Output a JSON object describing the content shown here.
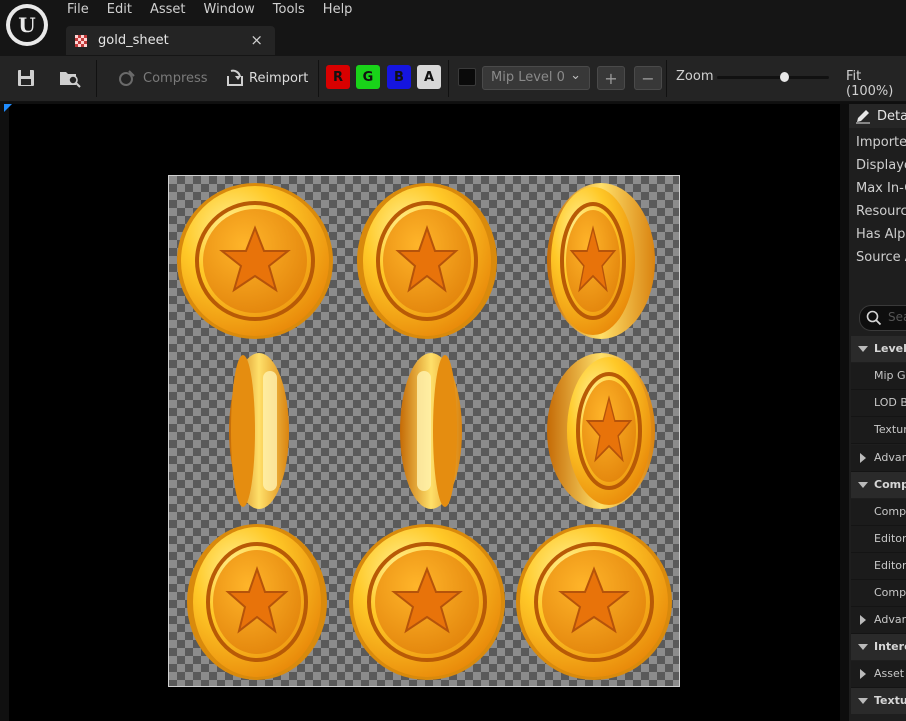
{
  "menu": [
    "File",
    "Edit",
    "Asset",
    "Window",
    "Tools",
    "Help"
  ],
  "tab": {
    "label": "gold_sheet",
    "close": "×"
  },
  "toolbar": {
    "compress": "Compress",
    "reimport": "Reimport",
    "channels": [
      {
        "label": "R",
        "bg": "#d80000",
        "fg": "#111111"
      },
      {
        "label": "G",
        "bg": "#19d319",
        "fg": "#111111"
      },
      {
        "label": "B",
        "bg": "#1515e0",
        "fg": "#111111"
      },
      {
        "label": "A",
        "bg": "#d8d8d8",
        "fg": "#111111"
      }
    ],
    "mip_level": "Mip Level 0",
    "plus": "+",
    "minus": "−",
    "zoom_label": "Zoom",
    "zoom_value": 0.6,
    "fit": "Fit (100%)"
  },
  "details": {
    "title": "Details",
    "properties": [
      "Imported",
      "Displayed",
      "Max In-Game",
      "Resource",
      "Has Alpha",
      "Source A"
    ],
    "search_placeholder": "Search",
    "sections": [
      {
        "kind": "section",
        "label": "Level Of Detail",
        "expanded": true
      },
      {
        "kind": "row",
        "label": "Mip Gen Settings"
      },
      {
        "kind": "row",
        "label": "LOD Bias"
      },
      {
        "kind": "row",
        "label": "Texture Group"
      },
      {
        "kind": "collapsed",
        "label": "Advanced"
      },
      {
        "kind": "section",
        "label": "Compression",
        "expanded": true
      },
      {
        "kind": "row",
        "label": "Compression Settings"
      },
      {
        "kind": "row",
        "label": "Editor Default"
      },
      {
        "kind": "row",
        "label": "Editor Override"
      },
      {
        "kind": "row",
        "label": "Compression Quality"
      },
      {
        "kind": "collapsed",
        "label": "Advanced"
      },
      {
        "kind": "section",
        "label": "Interchange",
        "expanded": true
      },
      {
        "kind": "collapsed",
        "label": "Asset Import Data"
      },
      {
        "kind": "section",
        "label": "Texture",
        "expanded": true
      }
    ]
  },
  "colors": {
    "coin_light": "#ffe25a",
    "coin_mid": "#f7b617",
    "coin_dark": "#c76a08",
    "star": "#f08a12"
  }
}
